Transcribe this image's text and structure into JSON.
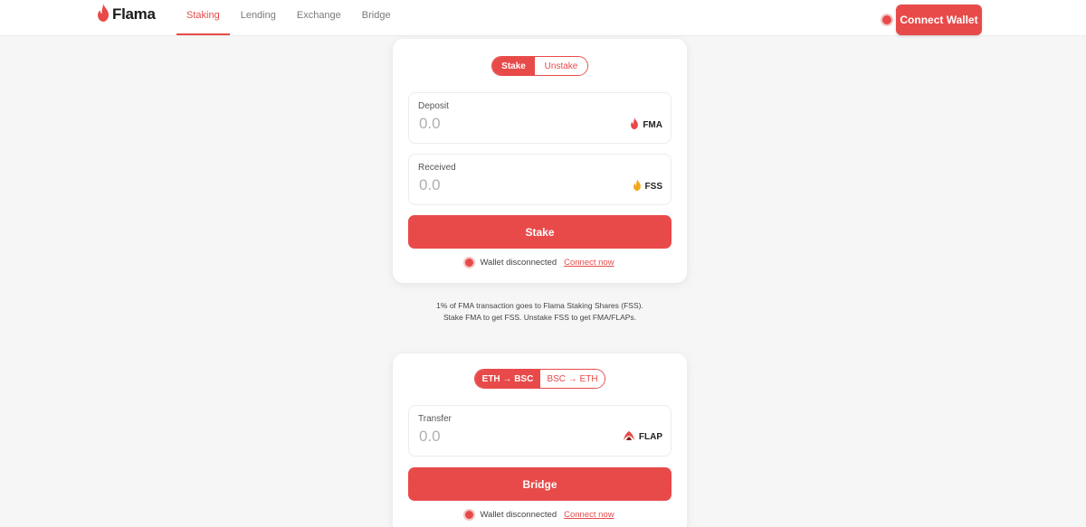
{
  "brand": {
    "name": "Flama",
    "accent": "#e84a4a"
  },
  "nav": [
    {
      "label": "Staking",
      "active": true
    },
    {
      "label": "Lending",
      "active": false
    },
    {
      "label": "Exchange",
      "active": false
    },
    {
      "label": "Bridge",
      "active": false
    }
  ],
  "header": {
    "connect_label": "Connect Wallet"
  },
  "staking": {
    "toggle": [
      "Stake",
      "Unstake"
    ],
    "deposit": {
      "label": "Deposit",
      "placeholder": "0.0",
      "token": "FMA",
      "token_icon": "flame-red-icon"
    },
    "received": {
      "label": "Received",
      "placeholder": "0.0",
      "token": "FSS",
      "token_icon": "flame-gold-icon"
    },
    "action_label": "Stake",
    "status_text": "Wallet disconnected",
    "status_link": "Connect now"
  },
  "info": {
    "line1": "1% of FMA transaction goes to Flama Staking Shares (FSS).",
    "line2": "Stake FMA to get FSS. Unstake FSS to get FMA/FLAPs."
  },
  "bridge": {
    "toggle": [
      "ETH → BSC",
      "BSC → ETH"
    ],
    "transfer": {
      "label": "Transfer",
      "placeholder": "0.0",
      "token": "FLAP",
      "token_icon": "flap-icon"
    },
    "action_label": "Bridge",
    "status_text": "Wallet disconnected",
    "status_link": "Connect now"
  }
}
